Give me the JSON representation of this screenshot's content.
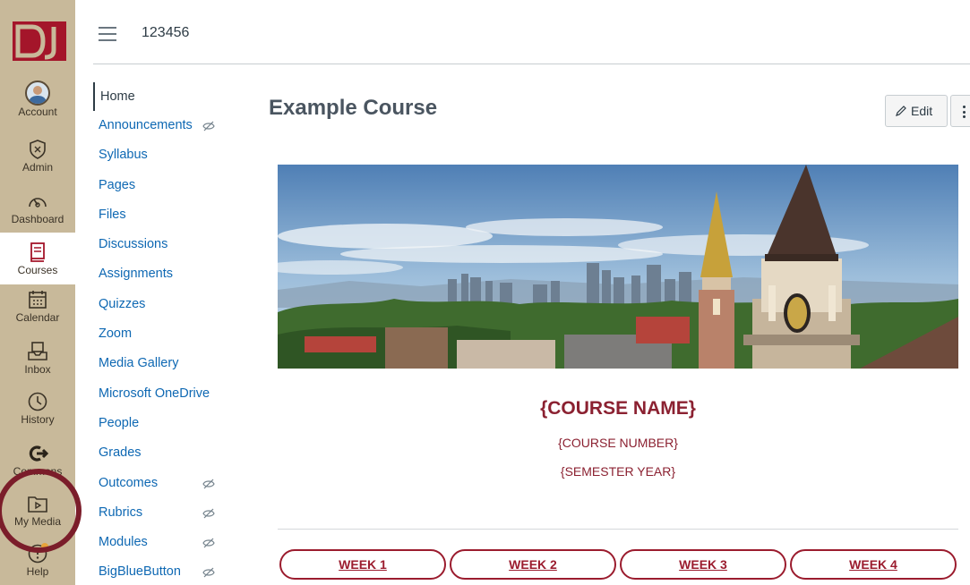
{
  "global_nav": {
    "items": [
      {
        "label": "Account",
        "icon": "account-avatar-icon"
      },
      {
        "label": "Admin",
        "icon": "shield-icon"
      },
      {
        "label": "Dashboard",
        "icon": "speedometer-icon"
      },
      {
        "label": "Courses",
        "icon": "book-icon"
      },
      {
        "label": "Calendar",
        "icon": "calendar-icon"
      },
      {
        "label": "Inbox",
        "icon": "inbox-icon"
      },
      {
        "label": "History",
        "icon": "clock-icon"
      },
      {
        "label": "Commons",
        "icon": "commons-arrow-icon"
      },
      {
        "label": "My Media",
        "icon": "media-folder-icon"
      },
      {
        "label": "Help",
        "icon": "help-icon"
      }
    ],
    "active": "Courses",
    "brand_color": "#c8b99a",
    "logo_color": "#a4152a"
  },
  "header": {
    "breadcrumb": "123456"
  },
  "course_nav": {
    "items": [
      {
        "label": "Home",
        "hidden": false
      },
      {
        "label": "Announcements",
        "hidden": true
      },
      {
        "label": "Syllabus",
        "hidden": false
      },
      {
        "label": "Pages",
        "hidden": false
      },
      {
        "label": "Files",
        "hidden": false
      },
      {
        "label": "Discussions",
        "hidden": false
      },
      {
        "label": "Assignments",
        "hidden": false
      },
      {
        "label": "Quizzes",
        "hidden": false
      },
      {
        "label": "Zoom",
        "hidden": false
      },
      {
        "label": "Media Gallery",
        "hidden": false
      },
      {
        "label": "Microsoft OneDrive",
        "hidden": false
      },
      {
        "label": "People",
        "hidden": false
      },
      {
        "label": "Grades",
        "hidden": false
      },
      {
        "label": "Outcomes",
        "hidden": true
      },
      {
        "label": "Rubrics",
        "hidden": true
      },
      {
        "label": "Modules",
        "hidden": true
      },
      {
        "label": "BigBlueButton",
        "hidden": true
      }
    ],
    "active": "Home"
  },
  "main": {
    "title": "Example Course",
    "edit_label": "Edit",
    "course_name": "{COURSE NAME}",
    "course_number": "{COURSE NUMBER}",
    "semester_year": "{SEMESTER YEAR}",
    "weeks": [
      "WEEK 1",
      "WEEK 2",
      "WEEK 3",
      "WEEK 4"
    ],
    "accent_color": "#9b1c2e"
  }
}
